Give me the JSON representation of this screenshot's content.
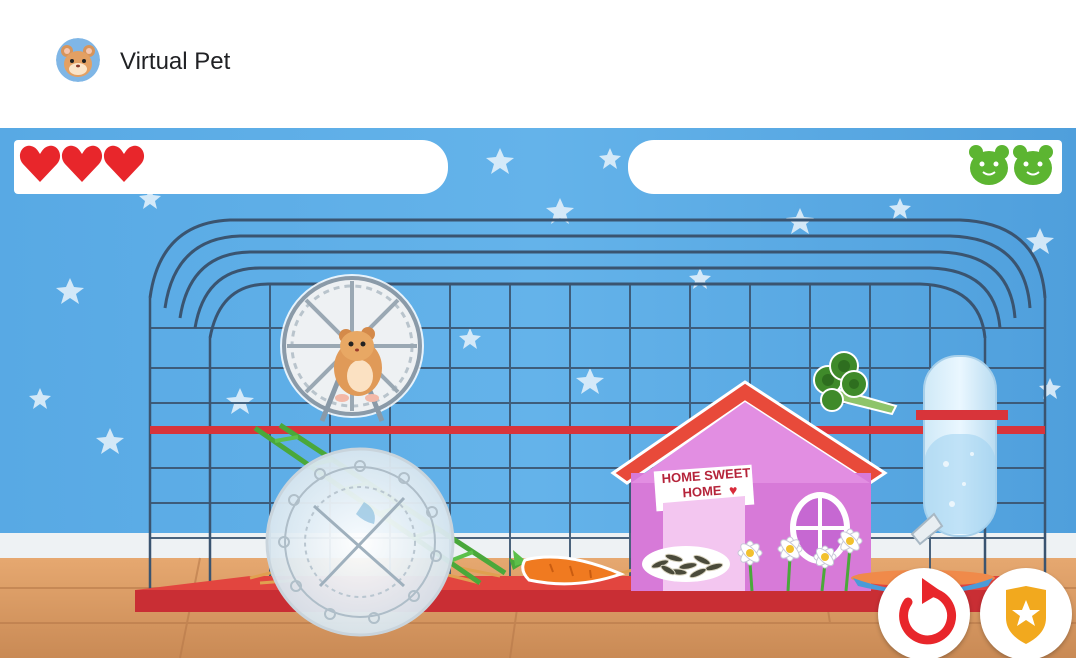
{
  "app": {
    "title": "Virtual Pet",
    "icon": "hamster-avatar-icon"
  },
  "status": {
    "hearts": 3,
    "heart_icon": "heart-icon",
    "pets": 2,
    "pet_icon": "hamster-face-icon",
    "heart_color": "#e8262b",
    "pet_color": "#5cb531"
  },
  "cage_items": [
    {
      "name": "hamster-wheel",
      "icon": "wheel-icon"
    },
    {
      "name": "hamster",
      "icon": "hamster-icon"
    },
    {
      "name": "hamster-ball",
      "icon": "ball-icon"
    },
    {
      "name": "carrot",
      "icon": "carrot-icon"
    },
    {
      "name": "seeds",
      "icon": "seeds-icon"
    },
    {
      "name": "broccoli",
      "icon": "broccoli-icon"
    },
    {
      "name": "water-bottle",
      "icon": "water-bottle-icon"
    },
    {
      "name": "food-bowl",
      "icon": "bowl-icon"
    },
    {
      "name": "flowers",
      "icon": "flowers-icon"
    }
  ],
  "house": {
    "sign_line1": "HOME SWEET",
    "sign_line2": "HOME"
  },
  "buttons": {
    "reset_icon": "reset-arrow-icon",
    "badge_icon": "star-badge-icon"
  },
  "colors": {
    "wallpaper": "#5aaee8",
    "floor": "#e0a06a",
    "cage_tray": "#d8343a",
    "roof": "#e84a3a",
    "house_wall": "#d879d8"
  }
}
